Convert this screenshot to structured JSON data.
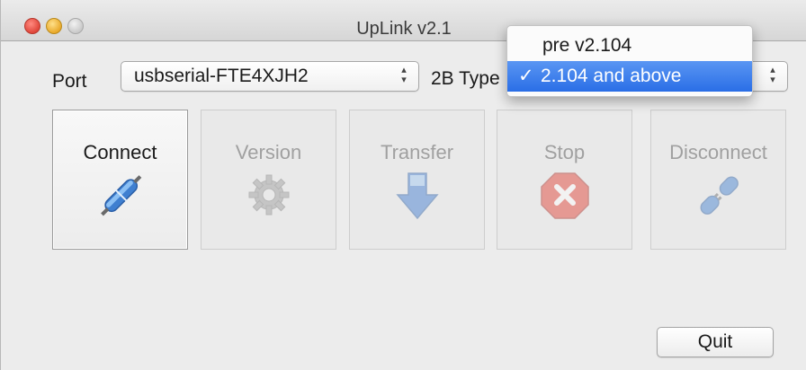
{
  "window": {
    "title": "UpLink v2.1"
  },
  "port": {
    "label": "Port",
    "value": "usbserial-FTE4XJH2"
  },
  "type": {
    "label": "2B Type",
    "options": [
      "pre v2.104",
      "2.104 and above"
    ],
    "selected": "2.104 and above",
    "check_mark": "✓"
  },
  "toolbar": {
    "connect": "Connect",
    "version": "Version",
    "transfer": "Transfer",
    "stop": "Stop",
    "disconnect": "Disconnect"
  },
  "quit_label": "Quit",
  "stepper_glyph": "⬍"
}
